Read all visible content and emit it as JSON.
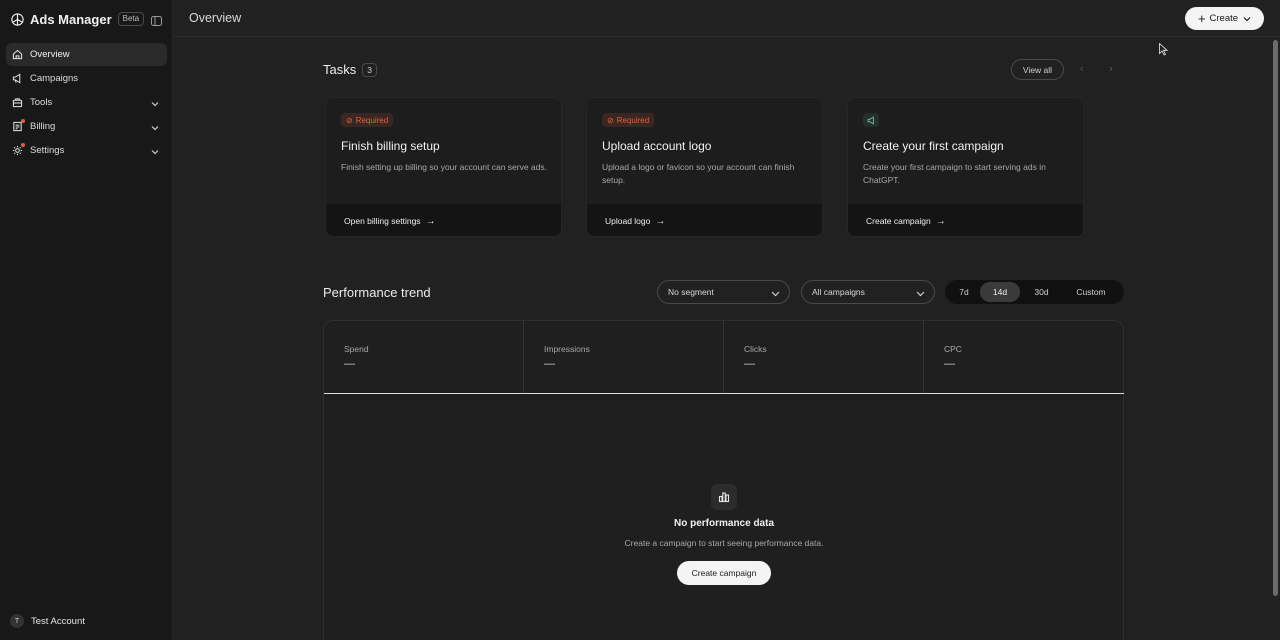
{
  "app": {
    "title": "Ads Manager",
    "beta_label": "Beta"
  },
  "sidebar": {
    "items": [
      {
        "label": "Overview",
        "icon": "home-icon"
      },
      {
        "label": "Campaigns",
        "icon": "megaphone-icon"
      },
      {
        "label": "Tools",
        "icon": "toolbox-icon"
      },
      {
        "label": "Billing",
        "icon": "receipt-icon"
      },
      {
        "label": "Settings",
        "icon": "gear-icon"
      }
    ],
    "account": {
      "initial": "T",
      "name": "Test Account"
    }
  },
  "header": {
    "title": "Overview",
    "create_label": "Create"
  },
  "tasks": {
    "title": "Tasks",
    "count": "3",
    "view_all_label": "View all",
    "cards": [
      {
        "badge": "Required",
        "title": "Finish billing setup",
        "description": "Finish setting up billing so your account can serve ads.",
        "action": "Open billing settings"
      },
      {
        "badge": "Required",
        "title": "Upload account logo",
        "description": "Upload a logo or favicon so your account can finish setup.",
        "action": "Upload logo"
      },
      {
        "badge": "",
        "title": "Create your first campaign",
        "description": "Create your first campaign to start serving ads in ChatGPT.",
        "action": "Create campaign"
      }
    ]
  },
  "performance": {
    "title": "Performance trend",
    "segment_value": "No segment",
    "campaign_value": "All campaigns",
    "ranges": [
      "7d",
      "14d",
      "30d",
      "Custom"
    ],
    "selected_range": "14d",
    "metrics": [
      {
        "label": "Spend",
        "value": "—"
      },
      {
        "label": "Impressions",
        "value": "—"
      },
      {
        "label": "Clicks",
        "value": "—"
      },
      {
        "label": "CPC",
        "value": "—"
      }
    ],
    "empty": {
      "title": "No performance data",
      "description": "Create a campaign to start seeing performance data.",
      "button": "Create campaign"
    }
  },
  "colors": {
    "accent_required": "#e0623a",
    "background": "#212121",
    "sidebar": "#181818"
  }
}
